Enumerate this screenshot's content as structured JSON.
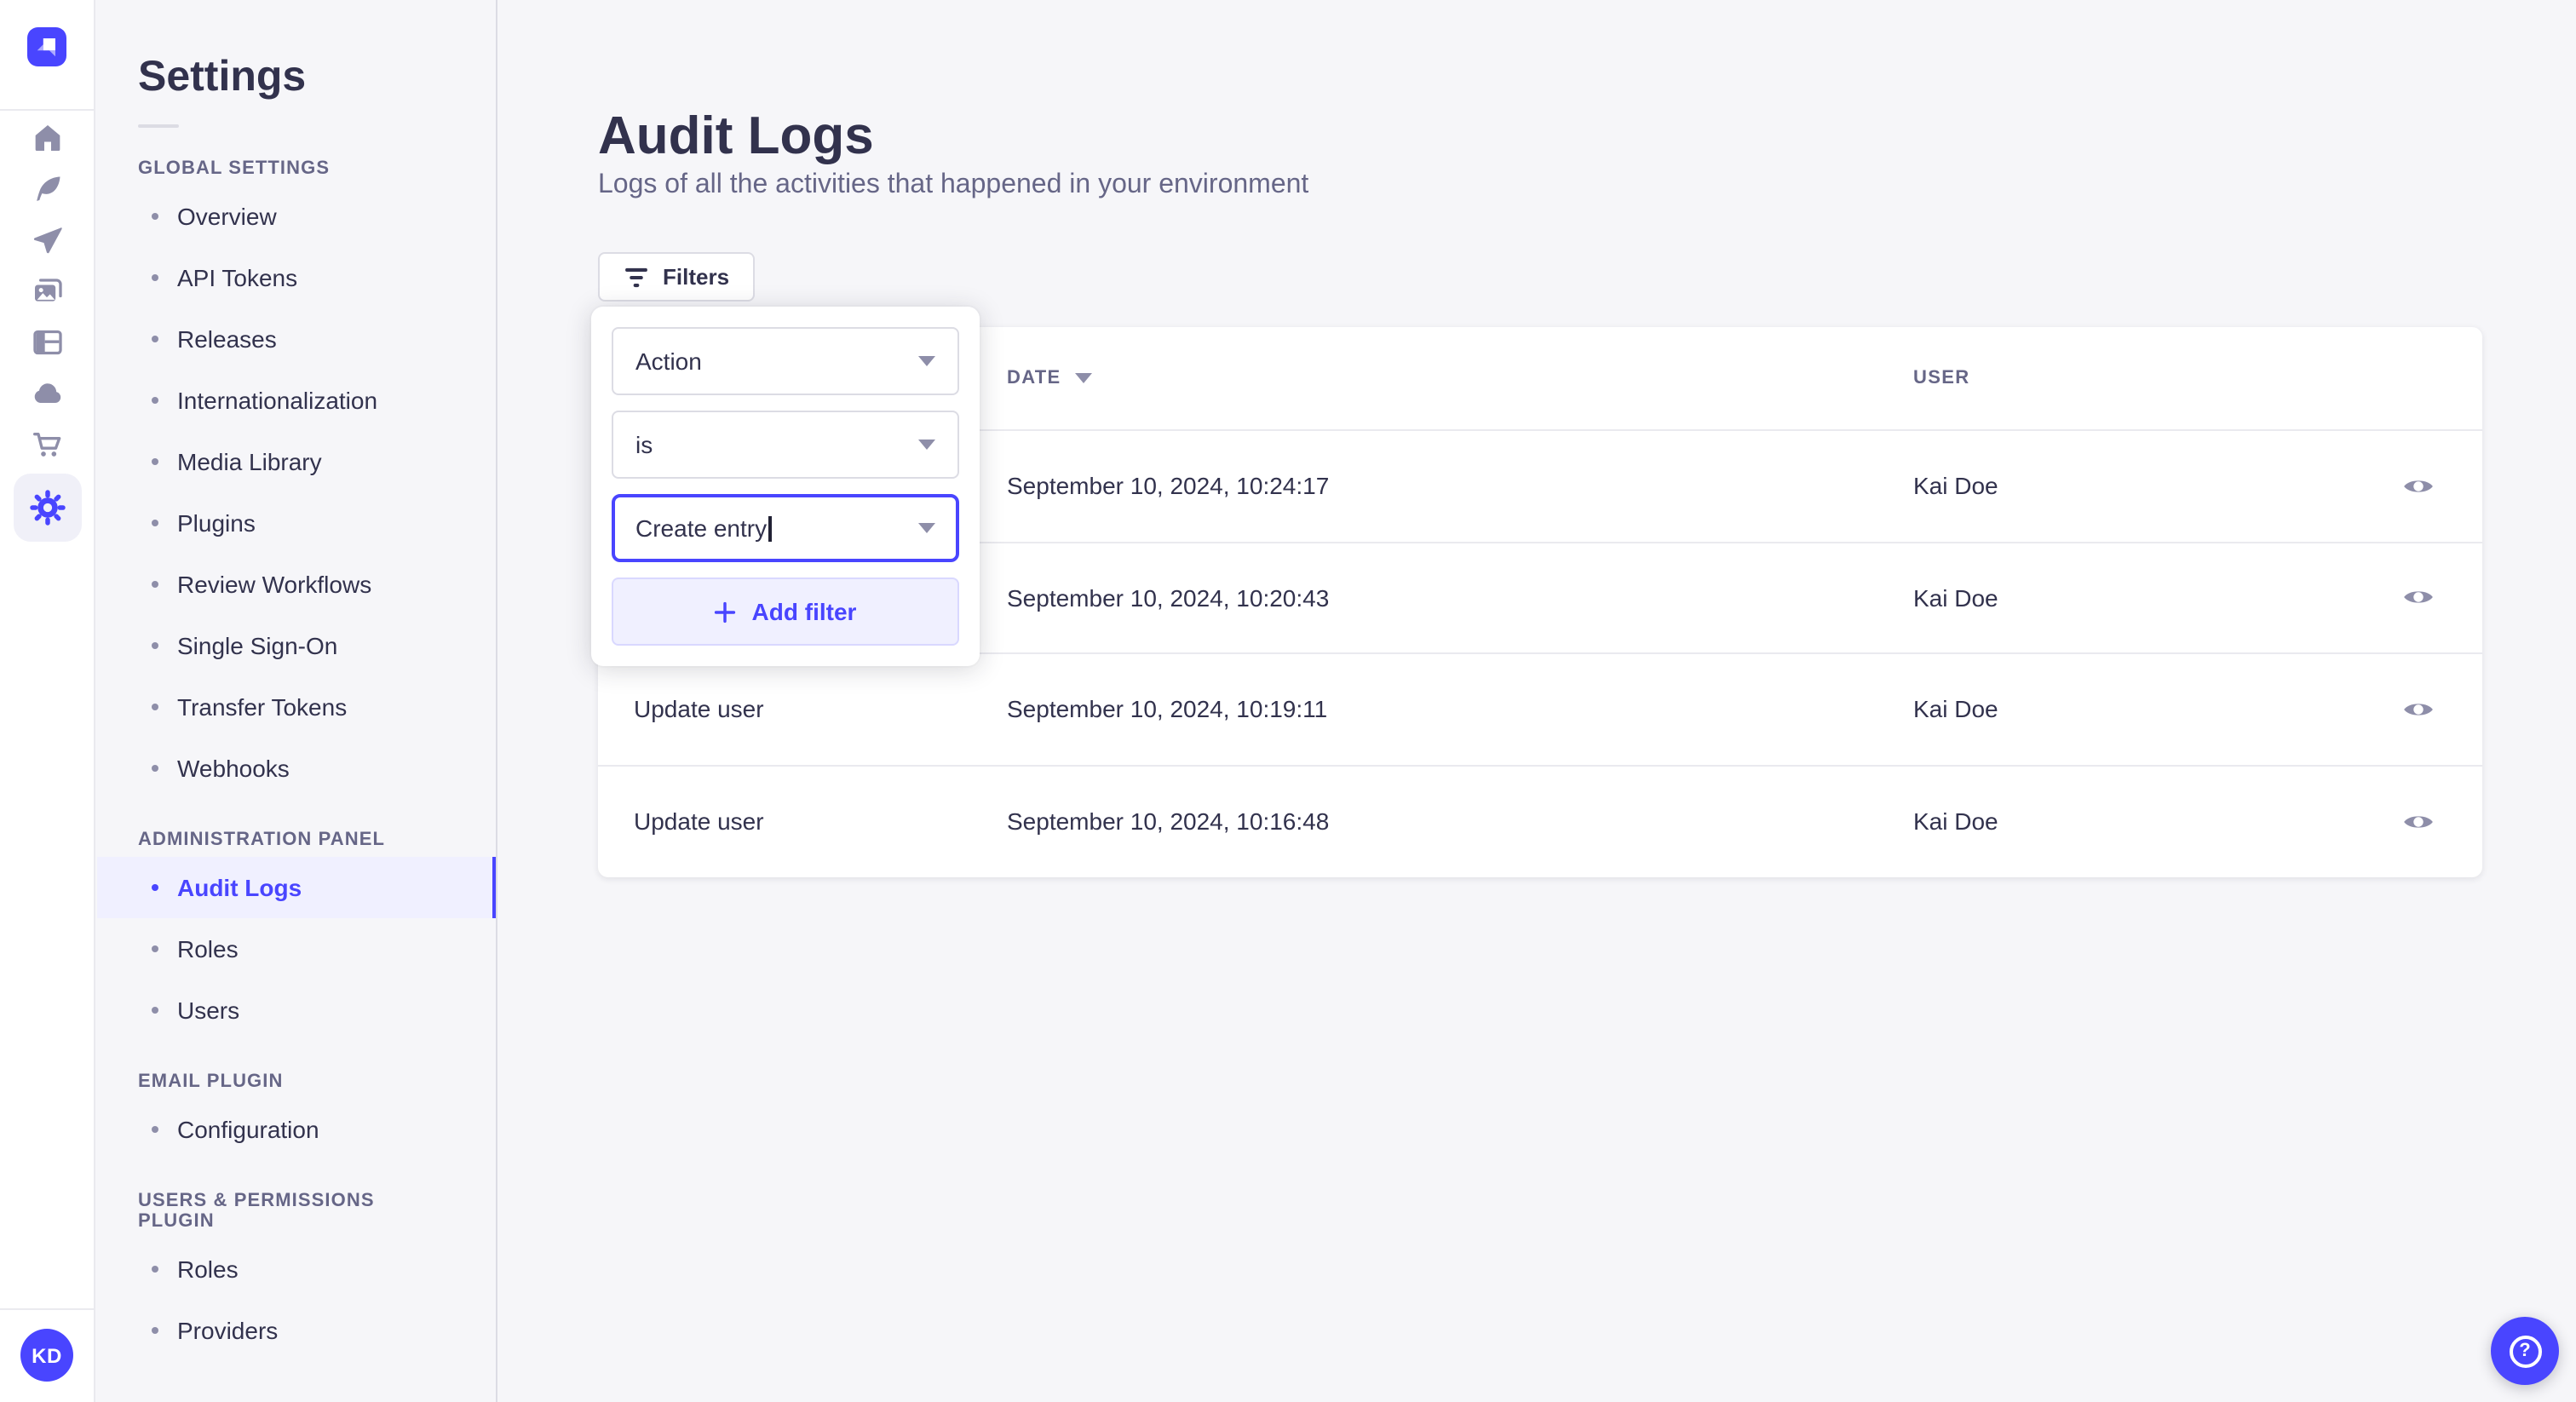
{
  "nav_strip": {
    "avatar_initials": "KD",
    "icons": [
      "home",
      "content-manager",
      "releases",
      "media-library",
      "content-type-builder",
      "cloud",
      "marketplace",
      "settings"
    ],
    "active_icon": "settings"
  },
  "sidebar": {
    "title": "Settings",
    "active_item": "Audit Logs",
    "sections": [
      {
        "label": "GLOBAL SETTINGS",
        "items": [
          "Overview",
          "API Tokens",
          "Releases",
          "Internationalization",
          "Media Library",
          "Plugins",
          "Review Workflows",
          "Single Sign-On",
          "Transfer Tokens",
          "Webhooks"
        ]
      },
      {
        "label": "ADMINISTRATION PANEL",
        "items": [
          "Audit Logs",
          "Roles",
          "Users"
        ]
      },
      {
        "label": "EMAIL PLUGIN",
        "items": [
          "Configuration"
        ]
      },
      {
        "label": "USERS & PERMISSIONS PLUGIN",
        "items": [
          "Roles",
          "Providers"
        ]
      }
    ]
  },
  "main": {
    "title": "Audit Logs",
    "subtitle": "Logs of all the activities that happened in your environment",
    "filters_button_label": "Filters",
    "filter_popup": {
      "field_select_value": "Action",
      "operator_select_value": "is",
      "value_input_value": "Create entry",
      "add_filter_label": "Add filter"
    },
    "table": {
      "headers": {
        "date": "DATE",
        "user": "USER"
      },
      "rows": [
        {
          "action": "",
          "date": "September 10, 2024, 10:24:17",
          "user": "Kai Doe"
        },
        {
          "action": "",
          "date": "September 10, 2024, 10:20:43",
          "user": "Kai Doe"
        },
        {
          "action": "Update user",
          "date": "September 10, 2024, 10:19:11",
          "user": "Kai Doe"
        },
        {
          "action": "Update user",
          "date": "September 10, 2024, 10:16:48",
          "user": "Kai Doe"
        }
      ]
    },
    "help_label": "?"
  },
  "colors": {
    "primary": "#4945FF",
    "primary_bg": "#F0F0FF",
    "text_dark": "#32324D",
    "text_gray": "#666687",
    "icon_gray": "#8E8EA9",
    "border": "#DCDCE4",
    "page_bg": "#F6F6F9"
  }
}
